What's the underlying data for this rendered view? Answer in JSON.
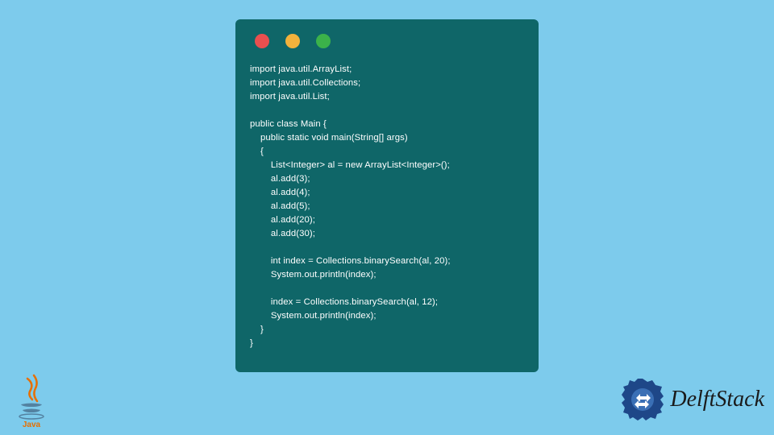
{
  "code": {
    "lines": [
      "import java.util.ArrayList;",
      "import java.util.Collections;",
      "import java.util.List;",
      "",
      "public class Main {",
      "    public static void main(String[] args)",
      "    {",
      "        List<Integer> al = new ArrayList<Integer>();",
      "        al.add(3);",
      "        al.add(4);",
      "        al.add(5);",
      "        al.add(20);",
      "        al.add(30);",
      "",
      "        int index = Collections.binarySearch(al, 20);",
      "        System.out.println(index);",
      "",
      "        index = Collections.binarySearch(al, 12);",
      "        System.out.println(index);",
      "    }",
      "}"
    ]
  },
  "logos": {
    "java": "Java",
    "delftstack": "DelftStack"
  },
  "colors": {
    "background": "#7dcbec",
    "codeWindow": "#0f6668",
    "dotRed": "#e94f4f",
    "dotYellow": "#f2b23c",
    "dotGreen": "#3bb24a"
  }
}
